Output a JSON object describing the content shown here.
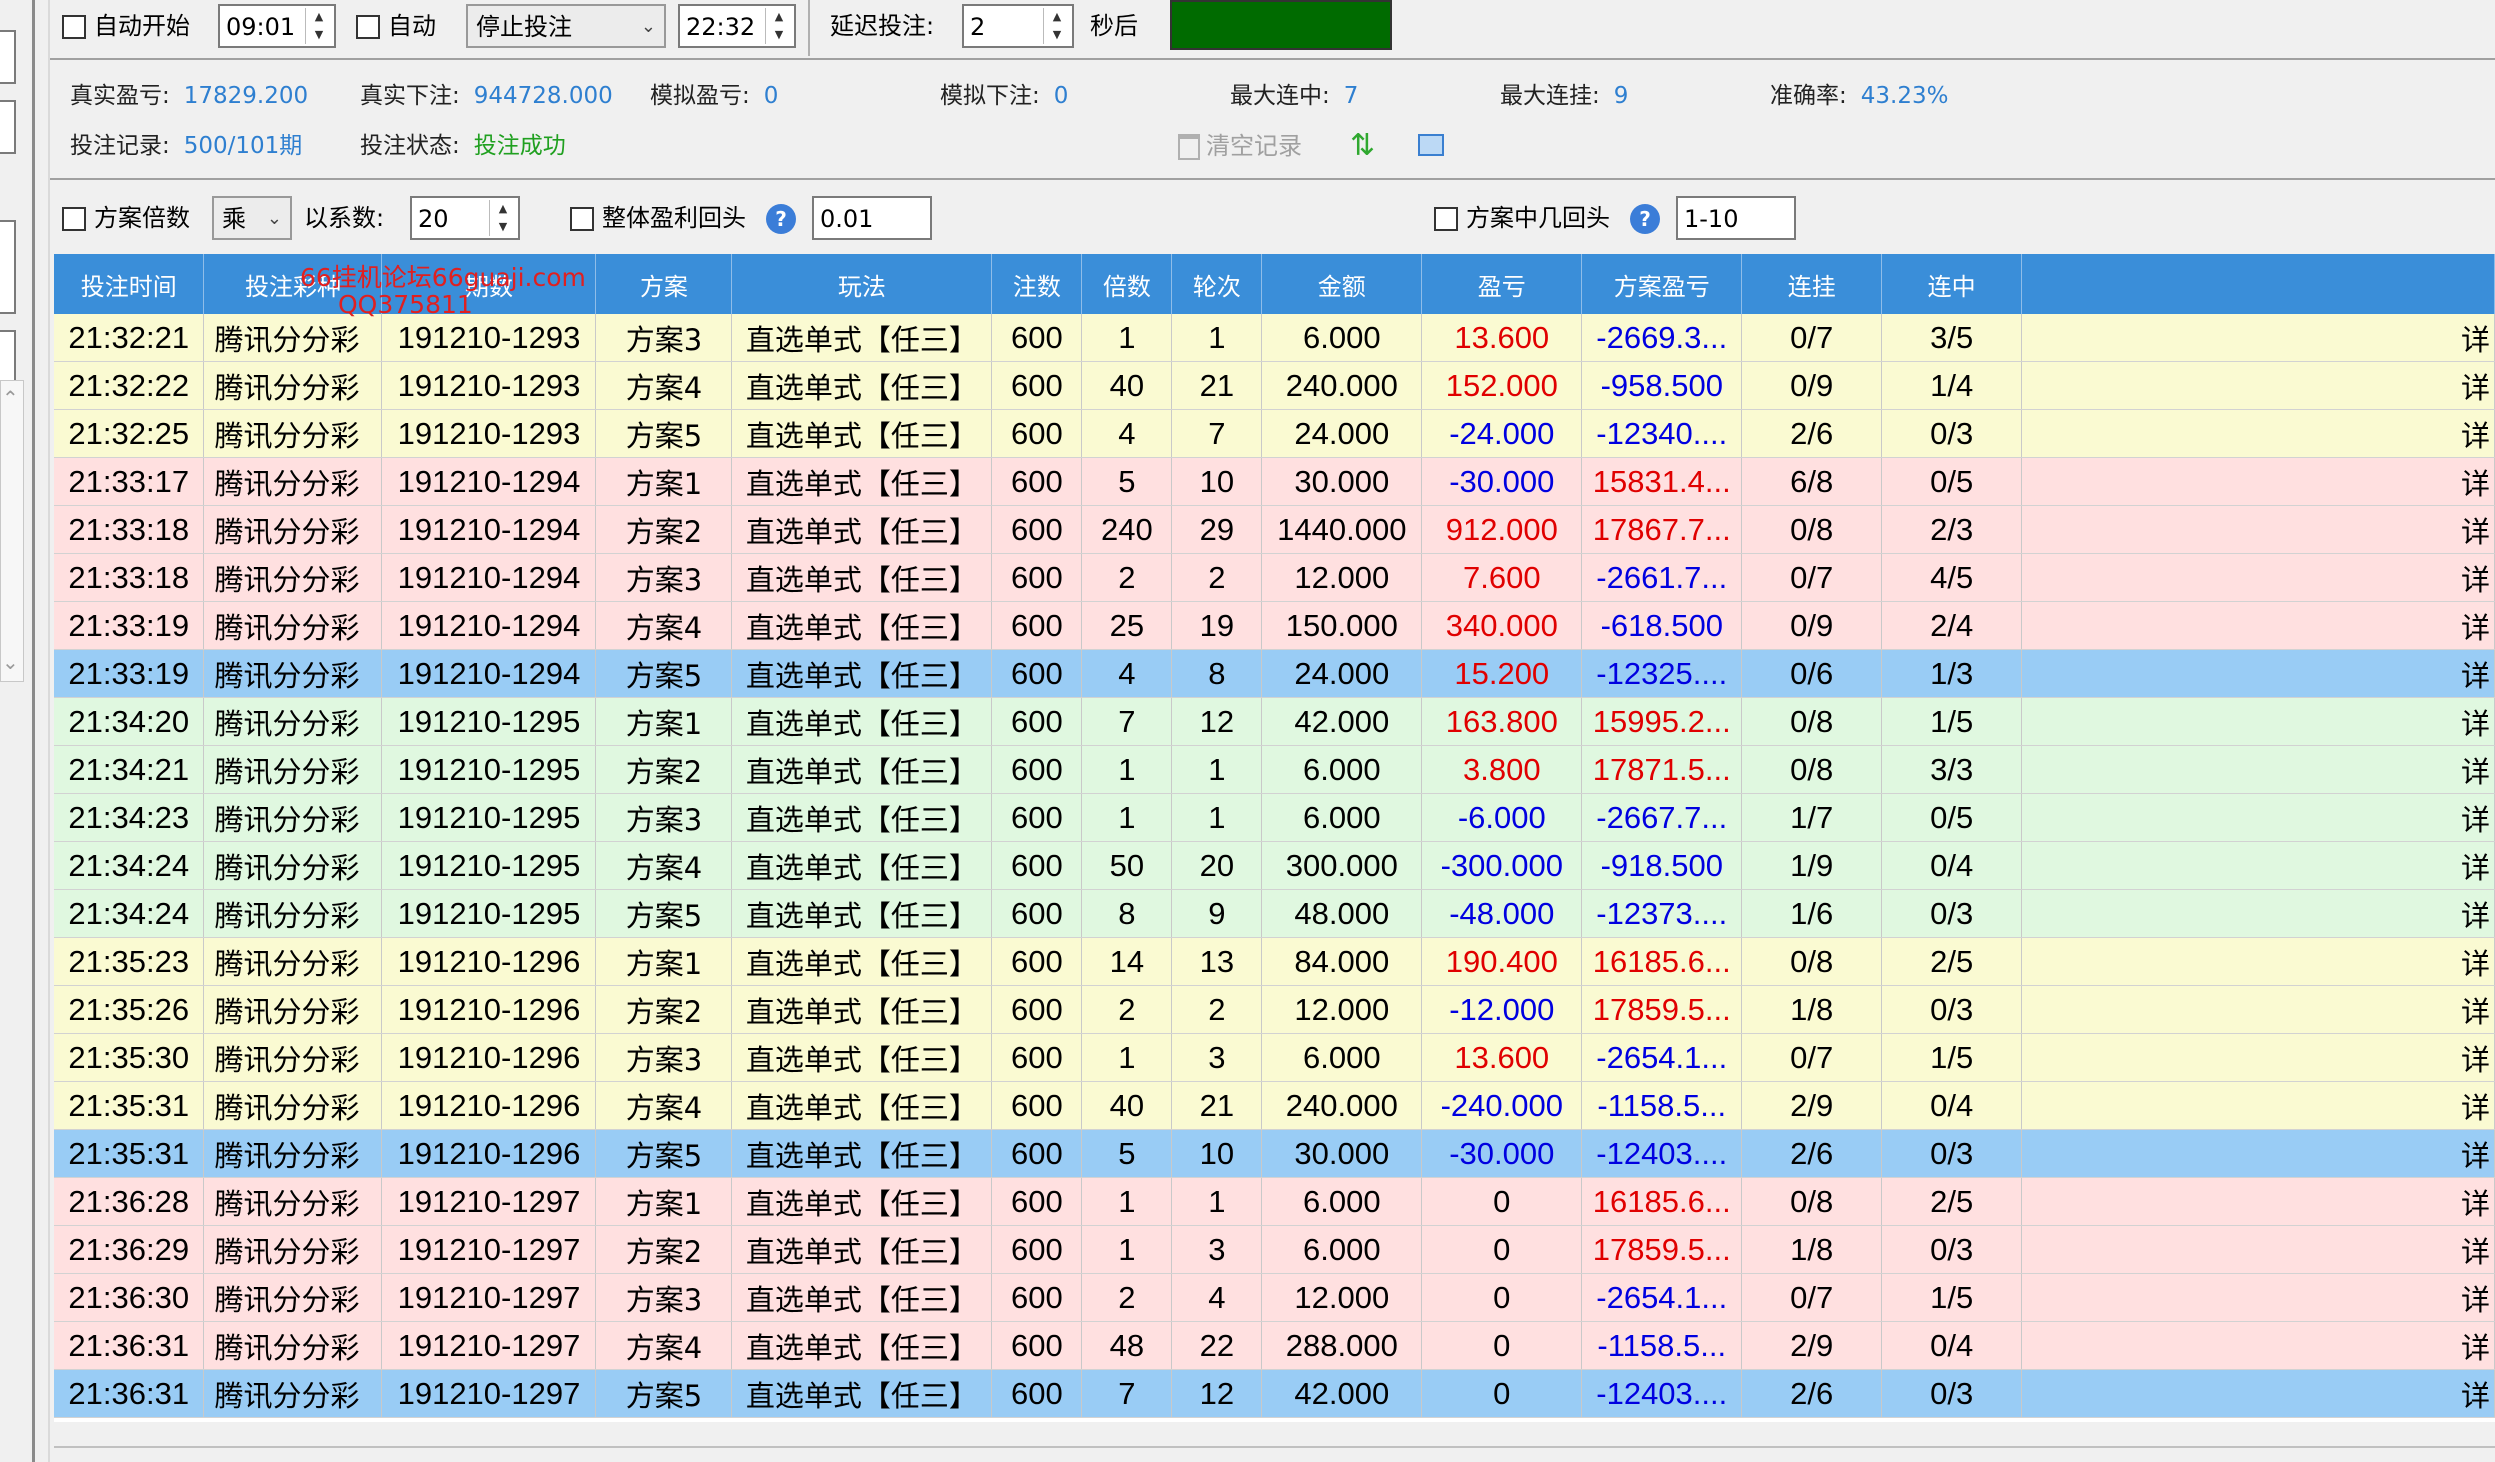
{
  "toolbar": {
    "auto_start_label": "自动开始",
    "auto_start_time": "09:01",
    "auto_label": "自动",
    "mode_value": "停止投注",
    "end_time": "22:32",
    "delay_label": "延迟投注:",
    "delay_value": "2",
    "delay_unit": "秒后",
    "status_color": "#006b00"
  },
  "stats": {
    "real_profit_label": "真实盈亏:",
    "real_profit": "17829.200",
    "real_bet_label": "真实下注:",
    "real_bet": "944728.000",
    "sim_profit_label": "模拟盈亏:",
    "sim_profit": "0",
    "sim_bet_label": "模拟下注:",
    "sim_bet": "0",
    "max_win_streak_label": "最大连中:",
    "max_win_streak": "7",
    "max_lose_streak_label": "最大连挂:",
    "max_lose_streak": "9",
    "accuracy_label": "准确率:",
    "accuracy": "43.23%",
    "record_label": "投注记录:",
    "record": "500/101期",
    "status_label": "投注状态:",
    "status": "投注成功",
    "clear_label": "清空记录"
  },
  "options": {
    "multiplier_label": "方案倍数",
    "multiplier_op": "乘",
    "coef_label": "以系数:",
    "coef_value": "20",
    "overall_label": "整体盈利回头",
    "overall_value": "0.01",
    "plan_back_label": "方案中几回头",
    "plan_back_value": "1-10"
  },
  "watermark": {
    "line1": "66挂机论坛66guaji.com",
    "line2": "QQ375811"
  },
  "table": {
    "headers": [
      "投注时间",
      "投注彩种",
      "期数",
      "方案",
      "玩法",
      "注数",
      "倍数",
      "轮次",
      "金额",
      "盈亏",
      "方案盈亏",
      "连挂",
      "连中",
      ""
    ],
    "rows": [
      {
        "time": "21:32:21",
        "lottery": "腾讯分分彩",
        "period": "191210-1293",
        "plan": "方案3",
        "play": "直选单式【任三】",
        "bets": "600",
        "mult": "1",
        "round": "1",
        "amount": "6.000",
        "profit": "13.600",
        "plan_profit": "-2669.3...",
        "lose": "0/7",
        "win": "3/5",
        "detail": "详",
        "bg": "#fafad2",
        "pc": "red",
        "ppc": "blue"
      },
      {
        "time": "21:32:22",
        "lottery": "腾讯分分彩",
        "period": "191210-1293",
        "plan": "方案4",
        "play": "直选单式【任三】",
        "bets": "600",
        "mult": "40",
        "round": "21",
        "amount": "240.000",
        "profit": "152.000",
        "plan_profit": "-958.500",
        "lose": "0/9",
        "win": "1/4",
        "detail": "详",
        "bg": "#fafad2",
        "pc": "red",
        "ppc": "blue"
      },
      {
        "time": "21:32:25",
        "lottery": "腾讯分分彩",
        "period": "191210-1293",
        "plan": "方案5",
        "play": "直选单式【任三】",
        "bets": "600",
        "mult": "4",
        "round": "7",
        "amount": "24.000",
        "profit": "-24.000",
        "plan_profit": "-12340....",
        "lose": "2/6",
        "win": "0/3",
        "detail": "详",
        "bg": "#fafad2",
        "pc": "blue",
        "ppc": "blue"
      },
      {
        "time": "21:33:17",
        "lottery": "腾讯分分彩",
        "period": "191210-1294",
        "plan": "方案1",
        "play": "直选单式【任三】",
        "bets": "600",
        "mult": "5",
        "round": "10",
        "amount": "30.000",
        "profit": "-30.000",
        "plan_profit": "15831.4...",
        "lose": "6/8",
        "win": "0/5",
        "detail": "详",
        "bg": "#ffe0e0",
        "pc": "blue",
        "ppc": "red"
      },
      {
        "time": "21:33:18",
        "lottery": "腾讯分分彩",
        "period": "191210-1294",
        "plan": "方案2",
        "play": "直选单式【任三】",
        "bets": "600",
        "mult": "240",
        "round": "29",
        "amount": "1440.000",
        "profit": "912.000",
        "plan_profit": "17867.7...",
        "lose": "0/8",
        "win": "2/3",
        "detail": "详",
        "bg": "#ffe0e0",
        "pc": "red",
        "ppc": "red"
      },
      {
        "time": "21:33:18",
        "lottery": "腾讯分分彩",
        "period": "191210-1294",
        "plan": "方案3",
        "play": "直选单式【任三】",
        "bets": "600",
        "mult": "2",
        "round": "2",
        "amount": "12.000",
        "profit": "7.600",
        "plan_profit": "-2661.7...",
        "lose": "0/7",
        "win": "4/5",
        "detail": "详",
        "bg": "#ffe0e0",
        "pc": "red",
        "ppc": "blue"
      },
      {
        "time": "21:33:19",
        "lottery": "腾讯分分彩",
        "period": "191210-1294",
        "plan": "方案4",
        "play": "直选单式【任三】",
        "bets": "600",
        "mult": "25",
        "round": "19",
        "amount": "150.000",
        "profit": "340.000",
        "plan_profit": "-618.500",
        "lose": "0/9",
        "win": "2/4",
        "detail": "详",
        "bg": "#ffe0e0",
        "pc": "red",
        "ppc": "blue"
      },
      {
        "time": "21:33:19",
        "lottery": "腾讯分分彩",
        "period": "191210-1294",
        "plan": "方案5",
        "play": "直选单式【任三】",
        "bets": "600",
        "mult": "4",
        "round": "8",
        "amount": "24.000",
        "profit": "15.200",
        "plan_profit": "-12325....",
        "lose": "0/6",
        "win": "1/3",
        "detail": "详",
        "bg": "#99ccf5",
        "pc": "red",
        "ppc": "blue"
      },
      {
        "time": "21:34:20",
        "lottery": "腾讯分分彩",
        "period": "191210-1295",
        "plan": "方案1",
        "play": "直选单式【任三】",
        "bets": "600",
        "mult": "7",
        "round": "12",
        "amount": "42.000",
        "profit": "163.800",
        "plan_profit": "15995.2...",
        "lose": "0/8",
        "win": "1/5",
        "detail": "详",
        "bg": "#e0f8e0",
        "pc": "red",
        "ppc": "red"
      },
      {
        "time": "21:34:21",
        "lottery": "腾讯分分彩",
        "period": "191210-1295",
        "plan": "方案2",
        "play": "直选单式【任三】",
        "bets": "600",
        "mult": "1",
        "round": "1",
        "amount": "6.000",
        "profit": "3.800",
        "plan_profit": "17871.5...",
        "lose": "0/8",
        "win": "3/3",
        "detail": "详",
        "bg": "#e0f8e0",
        "pc": "red",
        "ppc": "red"
      },
      {
        "time": "21:34:23",
        "lottery": "腾讯分分彩",
        "period": "191210-1295",
        "plan": "方案3",
        "play": "直选单式【任三】",
        "bets": "600",
        "mult": "1",
        "round": "1",
        "amount": "6.000",
        "profit": "-6.000",
        "plan_profit": "-2667.7...",
        "lose": "1/7",
        "win": "0/5",
        "detail": "详",
        "bg": "#e0f8e0",
        "pc": "blue",
        "ppc": "blue"
      },
      {
        "time": "21:34:24",
        "lottery": "腾讯分分彩",
        "period": "191210-1295",
        "plan": "方案4",
        "play": "直选单式【任三】",
        "bets": "600",
        "mult": "50",
        "round": "20",
        "amount": "300.000",
        "profit": "-300.000",
        "plan_profit": "-918.500",
        "lose": "1/9",
        "win": "0/4",
        "detail": "详",
        "bg": "#e0f8e0",
        "pc": "blue",
        "ppc": "blue"
      },
      {
        "time": "21:34:24",
        "lottery": "腾讯分分彩",
        "period": "191210-1295",
        "plan": "方案5",
        "play": "直选单式【任三】",
        "bets": "600",
        "mult": "8",
        "round": "9",
        "amount": "48.000",
        "profit": "-48.000",
        "plan_profit": "-12373....",
        "lose": "1/6",
        "win": "0/3",
        "detail": "详",
        "bg": "#e0f8e0",
        "pc": "blue",
        "ppc": "blue"
      },
      {
        "time": "21:35:23",
        "lottery": "腾讯分分彩",
        "period": "191210-1296",
        "plan": "方案1",
        "play": "直选单式【任三】",
        "bets": "600",
        "mult": "14",
        "round": "13",
        "amount": "84.000",
        "profit": "190.400",
        "plan_profit": "16185.6...",
        "lose": "0/8",
        "win": "2/5",
        "detail": "详",
        "bg": "#fafad2",
        "pc": "red",
        "ppc": "red"
      },
      {
        "time": "21:35:26",
        "lottery": "腾讯分分彩",
        "period": "191210-1296",
        "plan": "方案2",
        "play": "直选单式【任三】",
        "bets": "600",
        "mult": "2",
        "round": "2",
        "amount": "12.000",
        "profit": "-12.000",
        "plan_profit": "17859.5...",
        "lose": "1/8",
        "win": "0/3",
        "detail": "详",
        "bg": "#fafad2",
        "pc": "blue",
        "ppc": "red"
      },
      {
        "time": "21:35:30",
        "lottery": "腾讯分分彩",
        "period": "191210-1296",
        "plan": "方案3",
        "play": "直选单式【任三】",
        "bets": "600",
        "mult": "1",
        "round": "3",
        "amount": "6.000",
        "profit": "13.600",
        "plan_profit": "-2654.1...",
        "lose": "0/7",
        "win": "1/5",
        "detail": "详",
        "bg": "#fafad2",
        "pc": "red",
        "ppc": "blue"
      },
      {
        "time": "21:35:31",
        "lottery": "腾讯分分彩",
        "period": "191210-1296",
        "plan": "方案4",
        "play": "直选单式【任三】",
        "bets": "600",
        "mult": "40",
        "round": "21",
        "amount": "240.000",
        "profit": "-240.000",
        "plan_profit": "-1158.5...",
        "lose": "2/9",
        "win": "0/4",
        "detail": "详",
        "bg": "#fafad2",
        "pc": "blue",
        "ppc": "blue"
      },
      {
        "time": "21:35:31",
        "lottery": "腾讯分分彩",
        "period": "191210-1296",
        "plan": "方案5",
        "play": "直选单式【任三】",
        "bets": "600",
        "mult": "5",
        "round": "10",
        "amount": "30.000",
        "profit": "-30.000",
        "plan_profit": "-12403....",
        "lose": "2/6",
        "win": "0/3",
        "detail": "详",
        "bg": "#99ccf5",
        "pc": "blue",
        "ppc": "blue"
      },
      {
        "time": "21:36:28",
        "lottery": "腾讯分分彩",
        "period": "191210-1297",
        "plan": "方案1",
        "play": "直选单式【任三】",
        "bets": "600",
        "mult": "1",
        "round": "1",
        "amount": "6.000",
        "profit": "0",
        "plan_profit": "16185.6...",
        "lose": "0/8",
        "win": "2/5",
        "detail": "详",
        "bg": "#ffe0e0",
        "pc": "black",
        "ppc": "red"
      },
      {
        "time": "21:36:29",
        "lottery": "腾讯分分彩",
        "period": "191210-1297",
        "plan": "方案2",
        "play": "直选单式【任三】",
        "bets": "600",
        "mult": "1",
        "round": "3",
        "amount": "6.000",
        "profit": "0",
        "plan_profit": "17859.5...",
        "lose": "1/8",
        "win": "0/3",
        "detail": "详",
        "bg": "#ffe0e0",
        "pc": "black",
        "ppc": "red"
      },
      {
        "time": "21:36:30",
        "lottery": "腾讯分分彩",
        "period": "191210-1297",
        "plan": "方案3",
        "play": "直选单式【任三】",
        "bets": "600",
        "mult": "2",
        "round": "4",
        "amount": "12.000",
        "profit": "0",
        "plan_profit": "-2654.1...",
        "lose": "0/7",
        "win": "1/5",
        "detail": "详",
        "bg": "#ffe0e0",
        "pc": "black",
        "ppc": "blue"
      },
      {
        "time": "21:36:31",
        "lottery": "腾讯分分彩",
        "period": "191210-1297",
        "plan": "方案4",
        "play": "直选单式【任三】",
        "bets": "600",
        "mult": "48",
        "round": "22",
        "amount": "288.000",
        "profit": "0",
        "plan_profit": "-1158.5...",
        "lose": "2/9",
        "win": "0/4",
        "detail": "详",
        "bg": "#ffe0e0",
        "pc": "black",
        "ppc": "blue"
      },
      {
        "time": "21:36:31",
        "lottery": "腾讯分分彩",
        "period": "191210-1297",
        "plan": "方案5",
        "play": "直选单式【任三】",
        "bets": "600",
        "mult": "7",
        "round": "12",
        "amount": "42.000",
        "profit": "0",
        "plan_profit": "-12403....",
        "lose": "2/6",
        "win": "0/3",
        "detail": "详",
        "bg": "#99ccf5",
        "pc": "black",
        "ppc": "blue"
      }
    ]
  }
}
